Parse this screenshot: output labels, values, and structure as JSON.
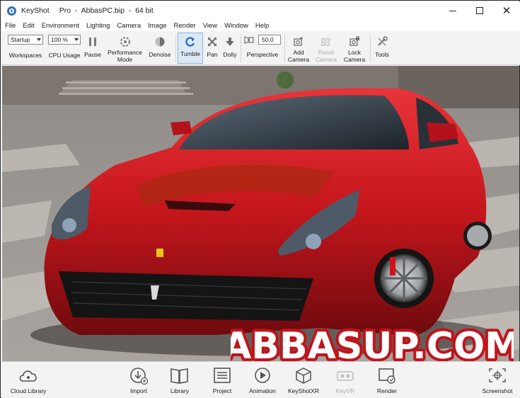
{
  "window": {
    "app_name": "KeyShot",
    "title_detail": "Pro  -  AbbasPC.bip  -  64 bit"
  },
  "menu": [
    "File",
    "Edit",
    "Environment",
    "Lighting",
    "Camera",
    "Image",
    "Render",
    "View",
    "Window",
    "Help"
  ],
  "toolbar": {
    "workspaces": {
      "value": "Startup",
      "label": "Workspaces"
    },
    "cpu_usage": {
      "value": "100 %",
      "label": "CPU Usage"
    },
    "pause": "Pause",
    "performance_mode_line1": "Performance",
    "performance_mode_line2": "Mode",
    "denoise": "Denoise",
    "tumble": "Tumble",
    "pan": "Pan",
    "dolly": "Dolly",
    "perspective": {
      "value": "50.0",
      "label": "Perspective"
    },
    "add_camera_line1": "Add",
    "add_camera_line2": "Camera",
    "reset_camera_line1": "Reset",
    "reset_camera_line2": "Camera",
    "lock_camera_line1": "Lock",
    "lock_camera_line2": "Camera",
    "tools": "Tools"
  },
  "viewport": {
    "watermark_text": "ABBASUP.COM",
    "car_color": "#c4161c"
  },
  "bottom": {
    "cloud_library": "Cloud Library",
    "import": "Import",
    "library": "Library",
    "project": "Project",
    "animation": "Animation",
    "keyshotxr": "KeyShotXR",
    "keyvr": "KeyVR",
    "render": "Render",
    "screenshot": "Screenshot"
  },
  "colors": {
    "accent": "#2f6fb6",
    "watermark_fill": "#ffffff",
    "watermark_outline": "#c0141c"
  }
}
